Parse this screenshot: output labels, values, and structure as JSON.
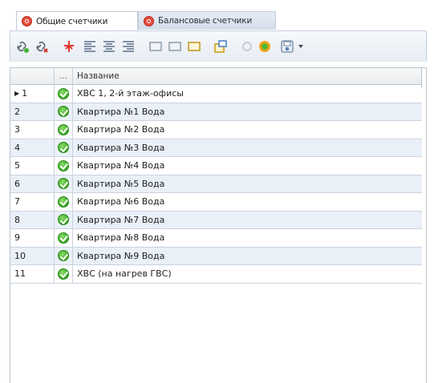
{
  "tabs": [
    {
      "label": "Общие счетчики",
      "active": true
    },
    {
      "label": "Балансовые счетчики",
      "active": false
    }
  ],
  "toolbar": {
    "icons": [
      "link-add-icon",
      "link-remove-icon",
      "pin-icon",
      "align-left-icon",
      "align-center-icon",
      "align-right-icon",
      "frame-left-icon",
      "frame-middle-icon",
      "frame-right-icon",
      "window-icon",
      "circle-disabled-icon",
      "circle-green-icon",
      "save-icon",
      "dropdown-arrow-icon"
    ]
  },
  "grid": {
    "columns": [
      "",
      "...",
      "Название"
    ],
    "rows": [
      {
        "num": "1",
        "name": "ХВС 1, 2-й этаж-офисы",
        "current": true
      },
      {
        "num": "2",
        "name": "Квартира №1 Вода"
      },
      {
        "num": "3",
        "name": "Квартира №2 Вода"
      },
      {
        "num": "4",
        "name": "Квартира №3 Вода"
      },
      {
        "num": "5",
        "name": "Квартира №4 Вода"
      },
      {
        "num": "6",
        "name": "Квартира №5 Вода"
      },
      {
        "num": "7",
        "name": "Квартира №6 Вода"
      },
      {
        "num": "8",
        "name": "Квартира №7 Вода"
      },
      {
        "num": "9",
        "name": "Квартира №8 Вода"
      },
      {
        "num": "10",
        "name": "Квартира №9 Вода"
      },
      {
        "num": "11",
        "name": "ХВС (на нагрев ГВС)"
      }
    ]
  }
}
